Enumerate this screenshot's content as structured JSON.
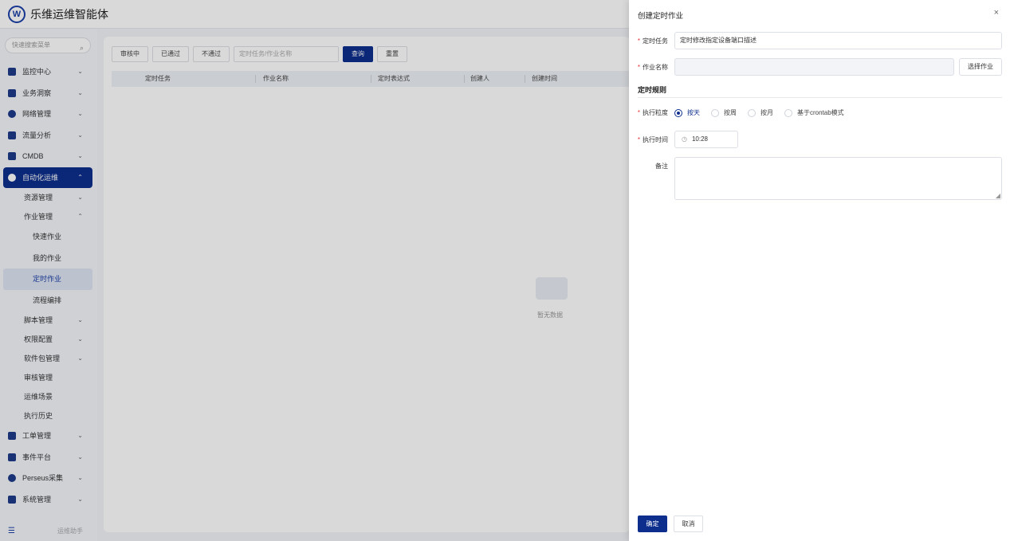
{
  "app": {
    "title": "乐维运维智能体",
    "logo_letter": "W"
  },
  "sidebar": {
    "search_placeholder": "快速搜索菜单",
    "items": [
      {
        "label": "监控中心",
        "level": 0
      },
      {
        "label": "业务洞察",
        "level": 0
      },
      {
        "label": "网络管理",
        "level": 0
      },
      {
        "label": "流量分析",
        "level": 0
      },
      {
        "label": "CMDB",
        "level": 0
      },
      {
        "label": "自动化运维",
        "level": 0,
        "active": true
      },
      {
        "label": "资源管理",
        "level": 1
      },
      {
        "label": "作业管理",
        "level": 1
      },
      {
        "label": "快速作业",
        "level": 2
      },
      {
        "label": "我的作业",
        "level": 2
      },
      {
        "label": "定时作业",
        "level": 2,
        "selected": true
      },
      {
        "label": "流程编排",
        "level": 2
      },
      {
        "label": "脚本管理",
        "level": 1
      },
      {
        "label": "权限配置",
        "level": 1
      },
      {
        "label": "软件包管理",
        "level": 1
      },
      {
        "label": "审核管理",
        "level": 1
      },
      {
        "label": "运维场景",
        "level": 1
      },
      {
        "label": "执行历史",
        "level": 1
      },
      {
        "label": "工单管理",
        "level": 0
      },
      {
        "label": "事件平台",
        "level": 0
      },
      {
        "label": "Perseus采集",
        "level": 0
      },
      {
        "label": "系统管理",
        "level": 0
      }
    ],
    "footer_text": "运维助手"
  },
  "filters": {
    "tabs": [
      "审核中",
      "已通过",
      "不通过"
    ],
    "search_placeholder": "定时任务/作业名称",
    "query_label": "查询",
    "reset_label": "重置"
  },
  "table": {
    "columns": [
      "定时任务",
      "作业名称",
      "定时表达式",
      "创建人",
      "创建时间"
    ],
    "empty_text": "暂无数据"
  },
  "drawer": {
    "title": "创建定时作业",
    "close_icon": "×",
    "task_label": "定时任务",
    "task_value": "定时修改指定设备端口描述",
    "job_label": "作业名称",
    "job_value": "",
    "select_job_label": "选择作业",
    "section_title": "定时规则",
    "granularity_label": "执行粒度",
    "granularity_options": [
      "按天",
      "按周",
      "按月",
      "基于crontab模式"
    ],
    "granularity_selected": 0,
    "time_label": "执行时间",
    "time_value": "10:28",
    "remark_label": "备注",
    "ok_label": "确定",
    "cancel_label": "取消"
  },
  "colors": {
    "primary": "#0d2e8c",
    "required": "#e53935"
  }
}
